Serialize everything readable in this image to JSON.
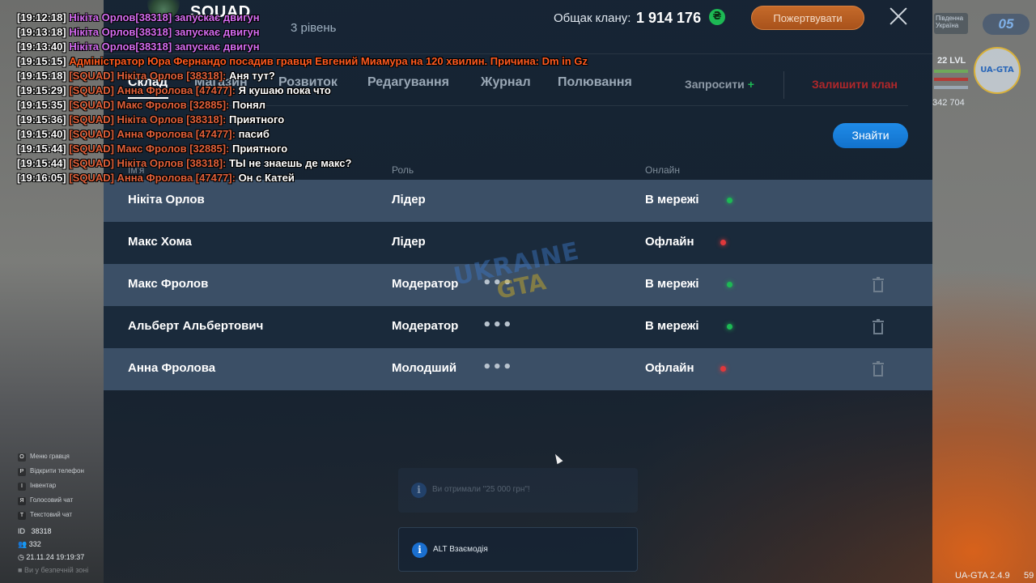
{
  "clan": {
    "name": "SQUAD",
    "level": "3 рівень",
    "treasury_label": "Общак клану:",
    "treasury_value": "1 914 176",
    "currency_symbol": "₴",
    "donate_label": "Пожертвувати"
  },
  "tabs": [
    {
      "label": "Склад",
      "active": true
    },
    {
      "label": "Магазин",
      "active": false
    },
    {
      "label": "Розвиток",
      "active": false
    },
    {
      "label": "Редагування",
      "active": false
    },
    {
      "label": "Журнал",
      "active": false
    },
    {
      "label": "Полювання",
      "active": false
    }
  ],
  "actions": {
    "invite_label": "Запросити",
    "invite_plus": "+",
    "leave_label": "Залишити клан"
  },
  "search": {
    "placeholder": "",
    "value": "",
    "button_label": "Знайти"
  },
  "table": {
    "columns": [
      "Ім'я",
      "Роль",
      "Онлайн"
    ],
    "rows": [
      {
        "name": "Нікіта Орлов",
        "role": "Лідер",
        "status": "В мережі",
        "online": true,
        "menu": "",
        "deletable": false
      },
      {
        "name": "Макс Хома",
        "role": "Лідер",
        "status": "Офлайн",
        "online": false,
        "menu": "",
        "deletable": false
      },
      {
        "name": "Макс Фролов",
        "role": "Модератор",
        "status": "В мережі",
        "online": true,
        "menu": "•••",
        "deletable": true
      },
      {
        "name": "Альберт Альбертович",
        "role": "Модератор",
        "status": "В мережі",
        "online": true,
        "menu": "•••",
        "deletable": true
      },
      {
        "name": "Анна Фролова",
        "role": "Молодший",
        "status": "Офлайн",
        "online": false,
        "menu": "•••",
        "deletable": true
      }
    ]
  },
  "watermark": {
    "top": "UKRAINE",
    "bottom": "GTA"
  },
  "chat": [
    {
      "time": "[19:12:18]",
      "prefix": "",
      "author": "Нікіта Орлов[38318]",
      "text": " запускає двигун",
      "type": "purple"
    },
    {
      "time": "[19:13:18]",
      "prefix": "",
      "author": "Нікіта Орлов[38318]",
      "text": " запускає двигун",
      "type": "purple"
    },
    {
      "time": "[19:13:40]",
      "prefix": "",
      "author": "Нікіта Орлов[38318]",
      "text": " запускає двигун",
      "type": "purple"
    },
    {
      "time": "[19:15:15]",
      "prefix": "",
      "author": "",
      "text": " Адміністратор Юра Фернандо посадив гравця Евгений Миамура на 120 хвилин. Причина: Dm in Gz",
      "type": "admin"
    },
    {
      "time": "[19:15:18]",
      "prefix": " [SQUAD]",
      "author": " Нікіта Орлов [38318]:",
      "text": " Аня тут?",
      "type": "squad"
    },
    {
      "time": "[19:15:29]",
      "prefix": " [SQUAD]",
      "author": " Анна Фролова [47477]:",
      "text": " Я кушаю пока что",
      "type": "squad"
    },
    {
      "time": "[19:15:35]",
      "prefix": " [SQUAD]",
      "author": " Макс Фролов [32885]:",
      "text": " Понял",
      "type": "squad"
    },
    {
      "time": "[19:15:36]",
      "prefix": " [SQUAD]",
      "author": " Нікіта Орлов [38318]:",
      "text": " Приятного",
      "type": "squad"
    },
    {
      "time": "[19:15:40]",
      "prefix": " [SQUAD]",
      "author": " Анна Фролова [47477]:",
      "text": " пасиб",
      "type": "squad"
    },
    {
      "time": "[19:15:44]",
      "prefix": " [SQUAD]",
      "author": " Макс Фролов [32885]:",
      "text": " Приятного",
      "type": "squad"
    },
    {
      "time": "[19:15:44]",
      "prefix": " [SQUAD]",
      "author": " Нікіта Орлов [38318]:",
      "text": " ТЫ не знаешь де макс?",
      "type": "squad"
    },
    {
      "time": "[19:16:05]",
      "prefix": " [SQUAD]",
      "author": " Анна Фролова [47477]:",
      "text": " Он с Катей",
      "type": "squad"
    }
  ],
  "hud_left": {
    "hints": [
      {
        "key": "O",
        "label": "Меню гравця"
      },
      {
        "key": "P",
        "label": "Відкрити телефон"
      },
      {
        "key": "I",
        "label": "Інвентар"
      },
      {
        "key": "Я",
        "label": "Голосовий чат"
      },
      {
        "key": "Т",
        "label": "Текстовий чат"
      }
    ],
    "id_label": "ID",
    "id_value": "38318",
    "online_count": "332",
    "datetime": "21.11.24 19:19:37",
    "zone": "Ви у безпечній зоні"
  },
  "hud_right": {
    "region": "Південна Україна",
    "badge": "05",
    "level": "22 LVL",
    "money": "342 704",
    "version": "UA-GTA 2.4.9",
    "fps": "59"
  },
  "notifications": {
    "ghost_text": "Ви отримали \"25 000 грн\"!",
    "active_text": "ALT Взаємодія",
    "info_symbol": "i"
  },
  "colors": {
    "accent_blue": "#1f8be8",
    "donate_orange": "#c56a2a",
    "online_green": "#1db954",
    "offline_red": "#e0383b",
    "leave_red": "#b0272a",
    "chat_purple": "#d46cf0",
    "chat_admin": "#ff5a1f",
    "chat_squad": "#e0603a"
  }
}
